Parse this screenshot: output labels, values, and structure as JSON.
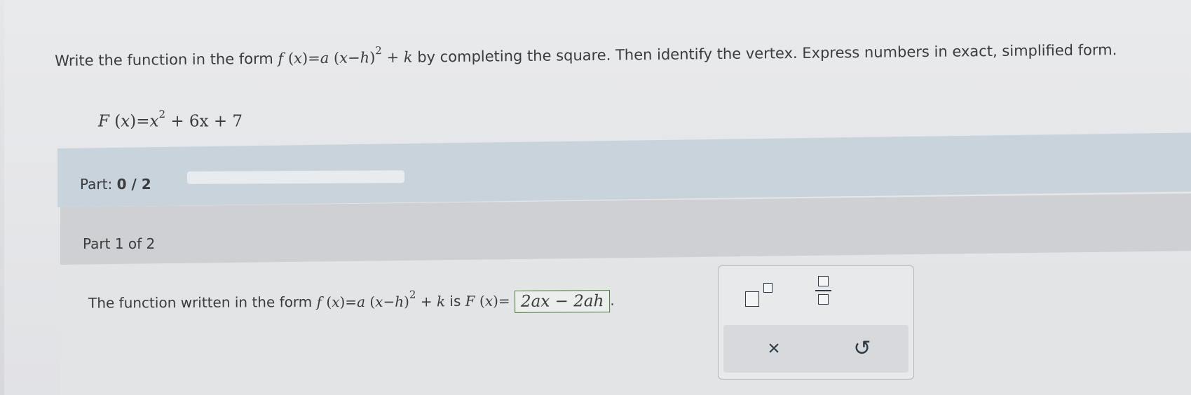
{
  "question": {
    "lead": "Write the function in the form ",
    "form_f": "f",
    "form_x": "x",
    "form_a": "a",
    "form_h": "h",
    "form_exp": "2",
    "form_k": "k",
    "tail": " by completing the square. Then identify the vertex. Express numbers in exact, simplified form."
  },
  "given": {
    "name": "F",
    "var": "x",
    "rhs_x": "x",
    "rhs_exp": "2",
    "rest": " + 6x + 7"
  },
  "progress": {
    "label": "Part: ",
    "done": "0",
    "sep": " / ",
    "total": "2",
    "fraction": 0
  },
  "section": {
    "title": "Part 1 of 2"
  },
  "answer": {
    "lead": "The function written in the form ",
    "form_exp": "2",
    "mid": " is ",
    "lhs_name": "F",
    "lhs_var": "x",
    "value": "2ax − 2ah",
    "end": "."
  },
  "palette": {
    "exponent_icon": "superscript-template-icon",
    "fraction_icon": "fraction-template-icon",
    "clear_symbol": "×",
    "undo_symbol": "↺"
  }
}
